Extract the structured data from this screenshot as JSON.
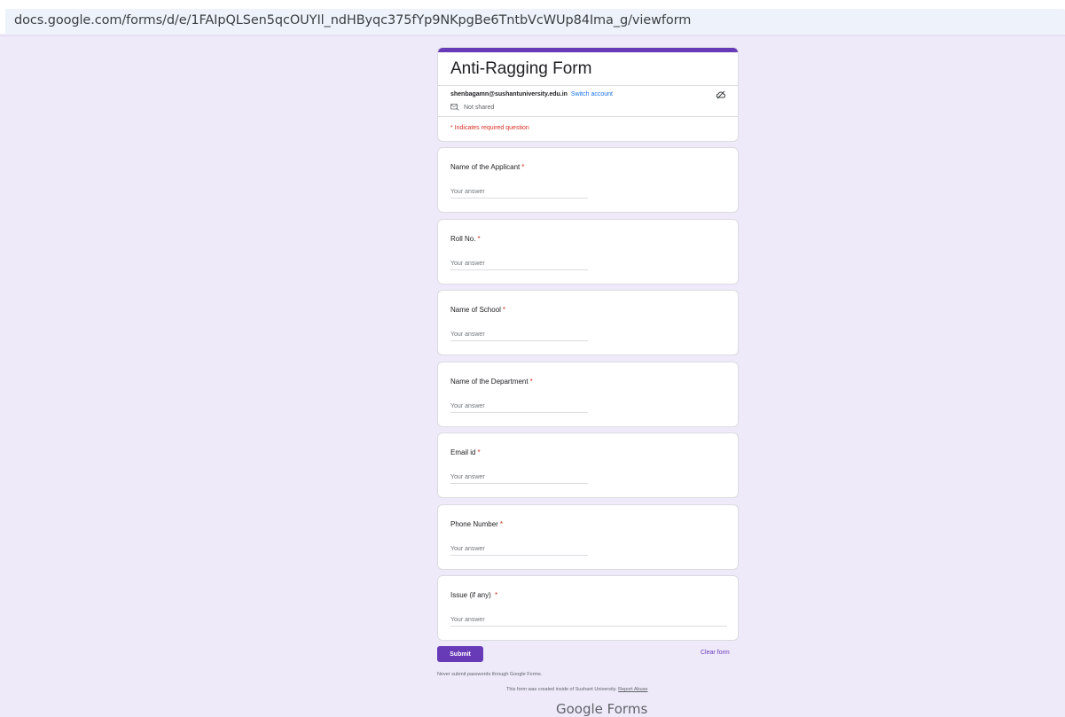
{
  "browser": {
    "url": "docs.google.com/forms/d/e/1FAIpQLSen5qcOUYIl_ndHByqc375fYp9NKpgBe6TntbVcWUp84Ima_g/viewform"
  },
  "form": {
    "title": "Anti-Ragging Form",
    "account_email": "shenbagamn@sushantuniversity.edu.in",
    "switch_account": "Switch account",
    "not_shared": "Not shared",
    "required_note": "* Indicates required question",
    "accent_color": "#673ab7"
  },
  "questions": [
    {
      "label": "Name of the Applicant",
      "required": "*",
      "placeholder": "Your answer"
    },
    {
      "label": "Roll No.",
      "required": "*",
      "placeholder": "Your answer"
    },
    {
      "label": "Name of School",
      "required": "*",
      "placeholder": "Your answer"
    },
    {
      "label": "Name of the Department",
      "required": "*",
      "placeholder": "Your answer"
    },
    {
      "label": "Email id",
      "required": "*",
      "placeholder": "Your answer"
    },
    {
      "label": "Phone Number",
      "required": "*",
      "placeholder": "Your answer"
    },
    {
      "label": "Issue (if any) ",
      "required": "*",
      "placeholder": "Your answer"
    }
  ],
  "actions": {
    "submit": "Submit",
    "clear": "Clear form"
  },
  "footer": {
    "never_submit": "Never submit passwords through Google Forms.",
    "created_note": "This form was created inside of Sushant University.",
    "report_abuse": "Report Abuse",
    "logo_text": "Google Forms"
  }
}
